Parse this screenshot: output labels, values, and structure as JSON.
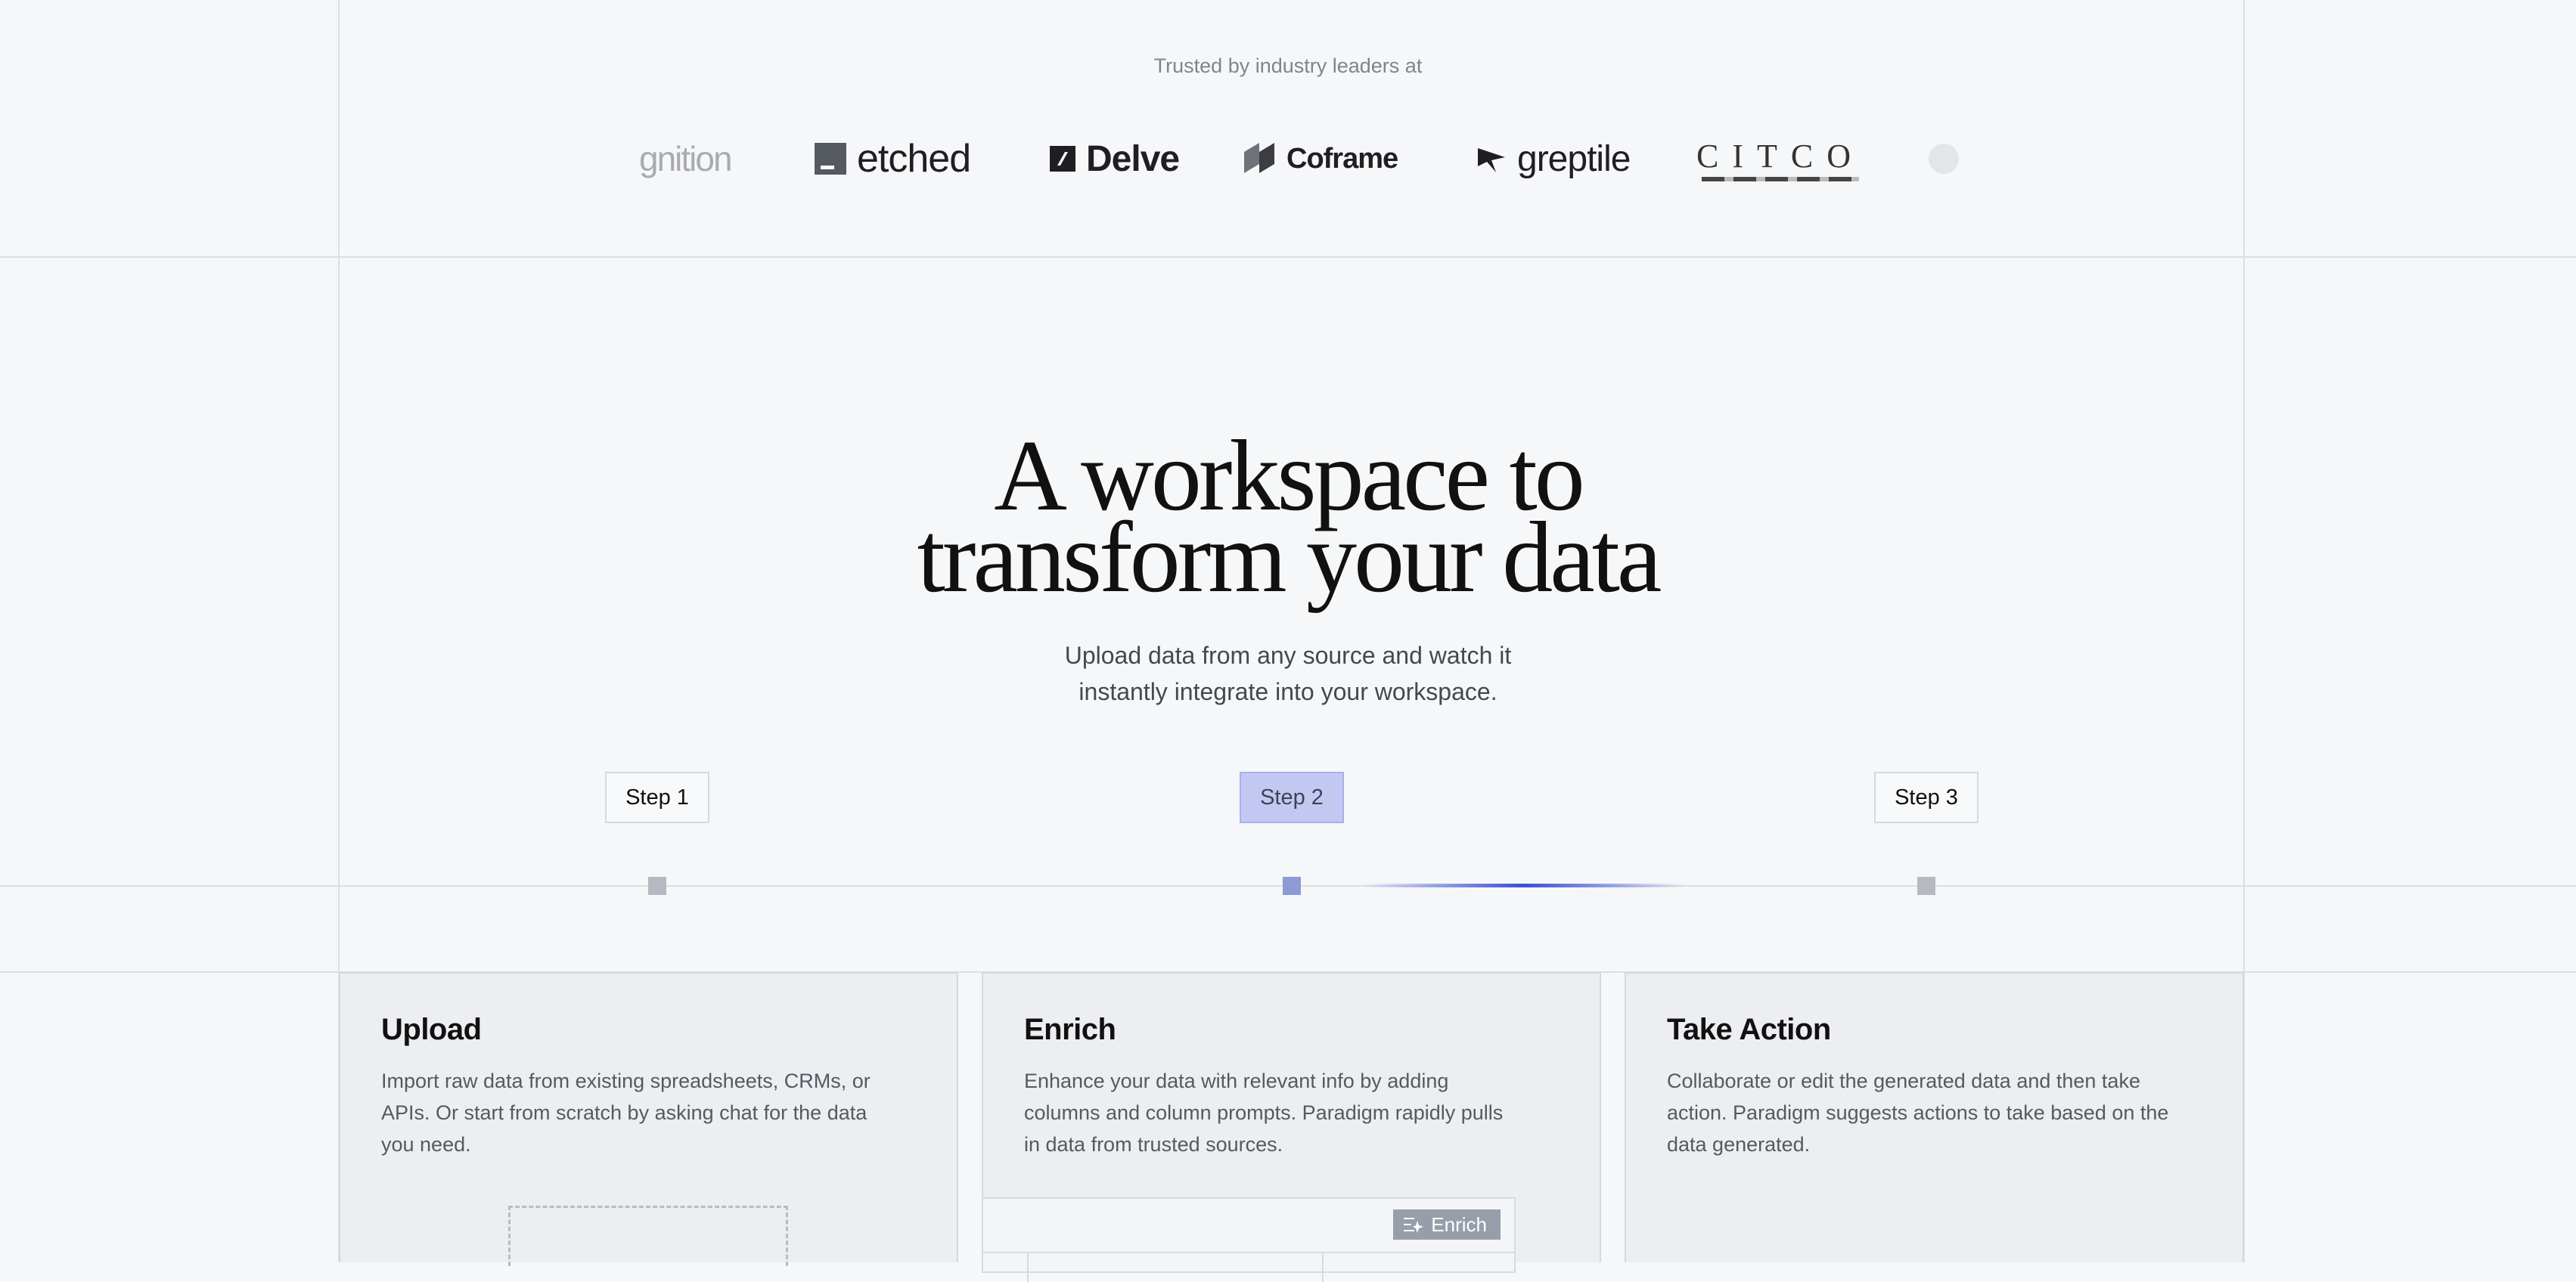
{
  "trusted": {
    "label": "Trusted by industry leaders at"
  },
  "logos": [
    {
      "name": "gnition"
    },
    {
      "name": "etched"
    },
    {
      "name": "Delve"
    },
    {
      "name": "Coframe"
    },
    {
      "name": "greptile"
    },
    {
      "name": "CITCO"
    }
  ],
  "hero": {
    "title_line1": "A workspace to",
    "title_line2": "transform your data",
    "subtitle_line1": "Upload data from any source and watch it",
    "subtitle_line2": "instantly integrate into your workspace."
  },
  "steps": [
    {
      "label": "Step 1",
      "active": false
    },
    {
      "label": "Step 2",
      "active": true
    },
    {
      "label": "Step 3",
      "active": false
    }
  ],
  "cards": [
    {
      "title": "Upload",
      "description": "Import raw data from existing spreadsheets, CRMs, or APIs. Or start from scratch by asking chat for the data you need."
    },
    {
      "title": "Enrich",
      "description": "Enhance your data with relevant info by adding columns and column prompts. Paradigm rapidly pulls in data from trusted sources."
    },
    {
      "title": "Take Action",
      "description": "Collaborate or edit the generated data and then take action. Paradigm suggests actions to take based on the data generated."
    }
  ],
  "enrich_button": {
    "label": "Enrich",
    "icon": "enrich-icon"
  },
  "colors": {
    "background": "#f6f7f8",
    "active_step": "#c3c8f3",
    "progress": "#3a4fd8",
    "card": "#eceef1"
  }
}
